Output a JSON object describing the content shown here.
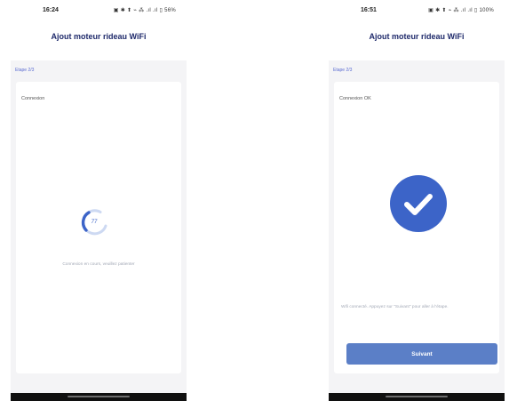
{
  "screens": [
    {
      "status": {
        "time": "16:24",
        "icons": "▣ ✱ ⬆ ⌁ ⁂ .ıl .ıl ▯ 56%"
      },
      "title": "Ajout moteur rideau WiFi",
      "step_label": "Etape 2/3",
      "card": {
        "heading": "Connexion",
        "spinner_value": "77",
        "message": "Connexion en cours, veuillez patienter"
      }
    },
    {
      "status": {
        "time": "16:51",
        "icons": "▣ ✱ ⬆ ⌁ ⁂ .ıl .ıl ▯ 100%"
      },
      "title": "Ajout moteur rideau WiFi",
      "step_label": "Etape 2/3",
      "card": {
        "heading": "Connexion OK",
        "message": "Wifi connecté. Appuyez sur \"Suivant\" pour aller à l'étape.",
        "next_label": "Suivant"
      }
    }
  ],
  "colors": {
    "accent": "#3c64c8",
    "title": "#1f2a6b",
    "button": "#5b7fc7"
  },
  "icons": {
    "loading": "loading-spinner-icon",
    "success": "check-circle-icon"
  }
}
